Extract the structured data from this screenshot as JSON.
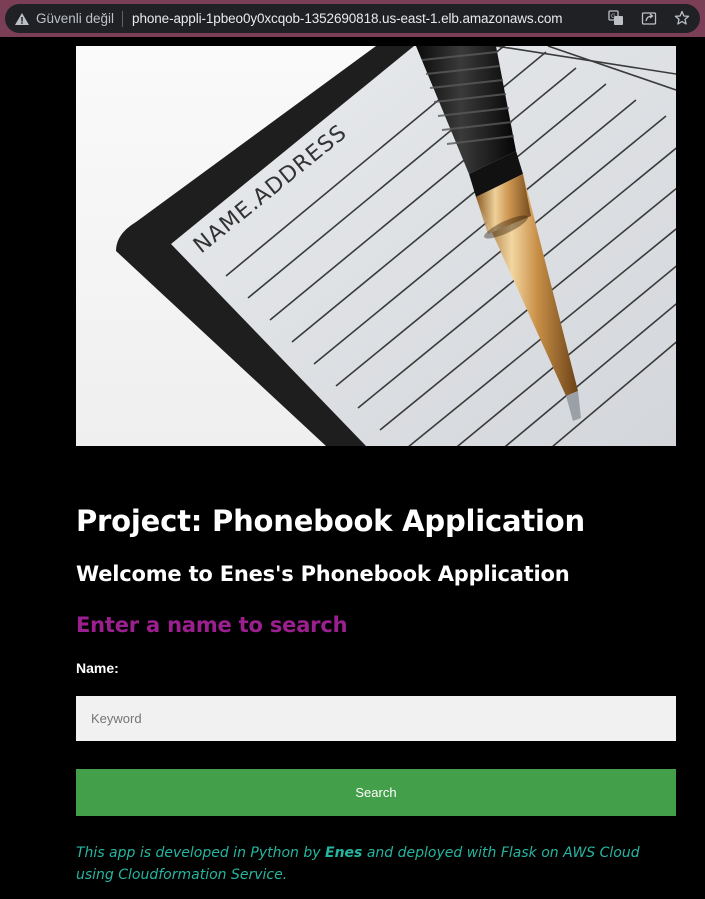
{
  "browser": {
    "security_label": "Güvenli değil",
    "url": "phone-appli-1pbeo0y0xcqob-1352690818.us-east-1.elb.amazonaws.com",
    "icons": [
      "warning-icon",
      "translate-icon",
      "share-icon",
      "star-icon"
    ]
  },
  "hero": {
    "notebook_text": "NAME.ADDRESS"
  },
  "page": {
    "title": "Project: Phonebook Application",
    "welcome": "Welcome to Enes's Phonebook Application",
    "search_heading": "Enter a name to search",
    "name_label": "Name:",
    "keyword_placeholder": "Keyword",
    "keyword_value": "",
    "search_button": "Search"
  },
  "footer": {
    "text_before": "This app is developed in Python by",
    "author": "Enes",
    "text_after": "and deployed with Flask on AWS Cloud using Cloudformation Service."
  },
  "colors": {
    "heading_accent": "#9c1f8f",
    "button_bg": "#449f4a",
    "footer_text": "#26b5a0",
    "chrome_frame": "#7a3e55"
  }
}
